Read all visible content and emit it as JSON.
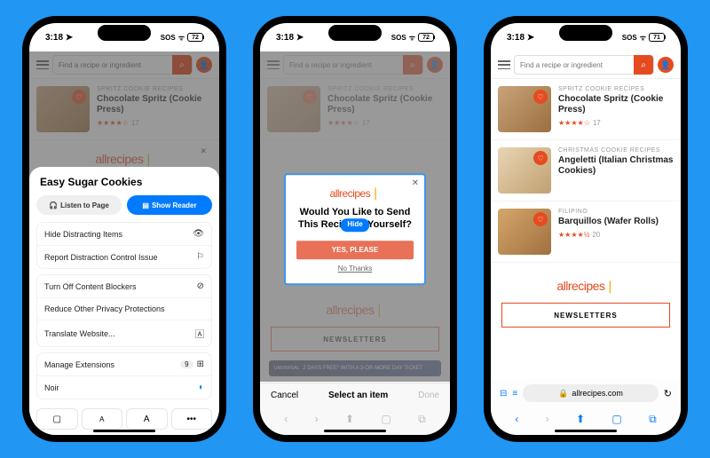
{
  "status": {
    "time": "3:18",
    "loc": "➤",
    "sos": "SOS",
    "wifi": "✕",
    "bat1": "72",
    "bat3": "71"
  },
  "search": {
    "placeholder": "Find a recipe or ingredient"
  },
  "recipes": [
    {
      "cat": "SPRITZ COOKIE RECIPES",
      "title": "Chocolate Spritz (Cookie Press)",
      "stars": "★★★★☆",
      "count": "17"
    },
    {
      "cat": "CHRISTMAS COOKIE RECIPES",
      "title": "Angeletti (Italian Christmas Cookies)",
      "stars": "",
      "count": ""
    },
    {
      "cat": "FILIPINO",
      "title": "Barquillos (Wafer Rolls)",
      "stars": "★★★★½",
      "count": "20"
    }
  ],
  "logo": {
    "text": "allrecipes"
  },
  "newsletters": "NEWSLETTERS",
  "ad": {
    "text": "2 DAYS FREE* WITH A 3-OR-MORE DAY TICKET"
  },
  "sheet": {
    "title": "Easy Sugar Cookies",
    "listen": "Listen to Page",
    "reader": "Show Reader",
    "hide_distracting": "Hide Distracting Items",
    "report": "Report Distraction Control Issue",
    "blockers": "Turn Off Content Blockers",
    "privacy": "Reduce Other Privacy Protections",
    "translate": "Translate Website...",
    "extensions": "Manage Extensions",
    "ext_count": "9",
    "noir": "Noir"
  },
  "popup": {
    "question": "Would You Like to Send This Recipe to Yourself?",
    "yes": "YES, PLEASE",
    "no": "No Thanks",
    "hide": "Hide"
  },
  "selectbar": {
    "cancel": "Cancel",
    "prompt": "Select an item",
    "done": "Done"
  },
  "url": {
    "host": "allrecipes.com"
  }
}
